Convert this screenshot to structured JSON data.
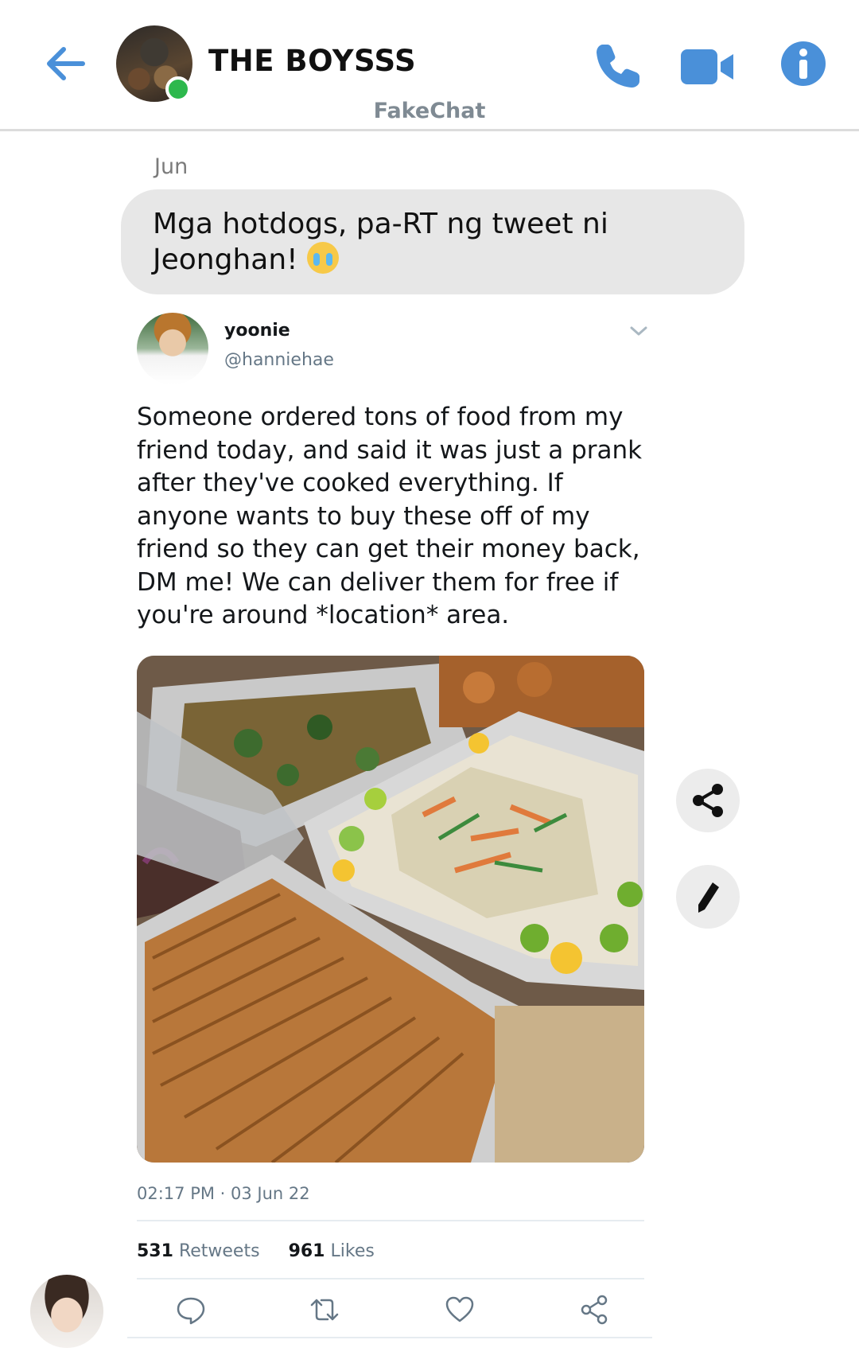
{
  "header": {
    "chat_title": "THE BOYSSS",
    "subtitle": "FakeChat"
  },
  "conversation": {
    "date_separator": "Jun",
    "message_text": "Mga hotdogs, pa-RT ng tweet ni Jeonghan!"
  },
  "tweet": {
    "display_name": "yoonie",
    "handle": "@hanniehae",
    "text": "Someone ordered tons of food from my friend today, and said it was just a prank after they've cooked everything. If anyone wants to buy these off of my friend so they can get their money back, DM me! We can deliver them for free if you're around *location* area.",
    "timestamp": "02:17 PM · 03 Jun 22",
    "retweets_count": "531",
    "retweets_label": "Retweets",
    "likes_count": "961",
    "likes_label": "Likes"
  },
  "icons": {
    "back": "back-arrow-icon",
    "call": "phone-icon",
    "video": "video-camera-icon",
    "info": "info-icon",
    "share_fab": "share-icon",
    "edit_fab": "pencil-icon",
    "reply": "reply-icon",
    "retweet": "retweet-icon",
    "like": "heart-icon",
    "share": "share-icon"
  },
  "colors": {
    "accent_blue": "#4a90d9",
    "online_green": "#2db84d",
    "bubble_gray": "#e7e7e7",
    "muted_text": "#657786"
  }
}
